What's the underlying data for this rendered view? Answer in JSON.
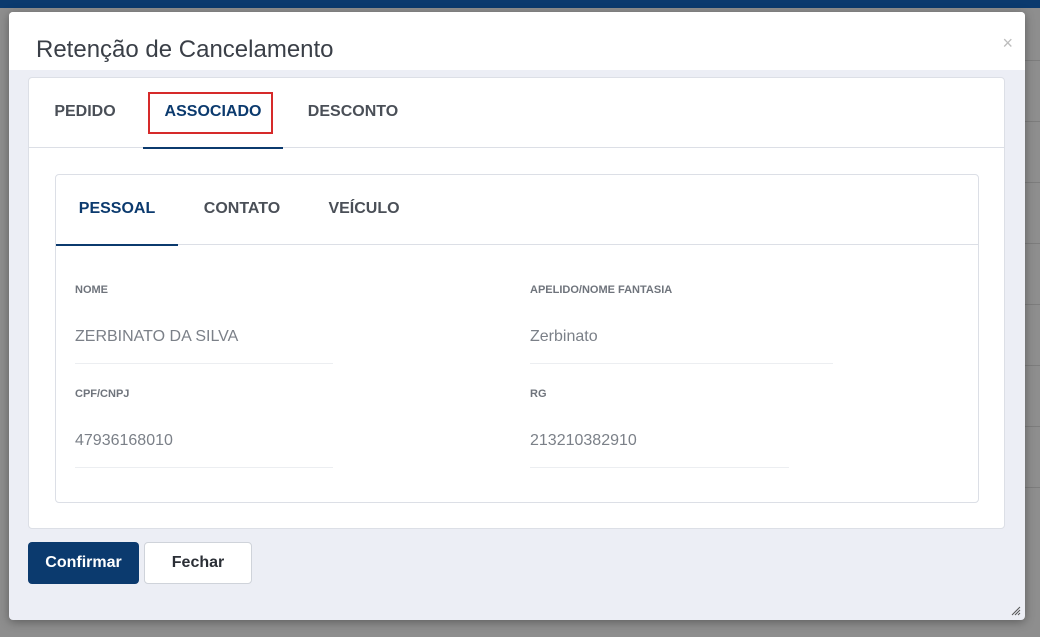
{
  "modal": {
    "title": "Retenção de Cancelamento",
    "close_glyph": "×"
  },
  "outer_tabs": [
    {
      "label": "PEDIDO",
      "active": false
    },
    {
      "label": "ASSOCIADO",
      "active": true
    },
    {
      "label": "DESCONTO",
      "active": false
    }
  ],
  "inner_tabs": [
    {
      "label": "PESSOAL",
      "active": true
    },
    {
      "label": "CONTATO",
      "active": false
    },
    {
      "label": "VEÍCULO",
      "active": false
    }
  ],
  "fields": {
    "nome": {
      "label": "NOME",
      "value": "ZERBINATO DA SILVA"
    },
    "apelido": {
      "label": "APELIDO/NOME FANTASIA",
      "value": "Zerbinato"
    },
    "cpf": {
      "label": "CPF/CNPJ",
      "value": "47936168010"
    },
    "rg": {
      "label": "RG",
      "value": "213210382910"
    }
  },
  "buttons": {
    "confirm_label": "Confirmar",
    "close_label": "Fechar"
  },
  "colors": {
    "primary": "#0b3a6e",
    "highlight": "#d62a2a",
    "backdrop": "#8e8e8e"
  },
  "icons": [
    "close-icon",
    "resize-grip-icon"
  ]
}
